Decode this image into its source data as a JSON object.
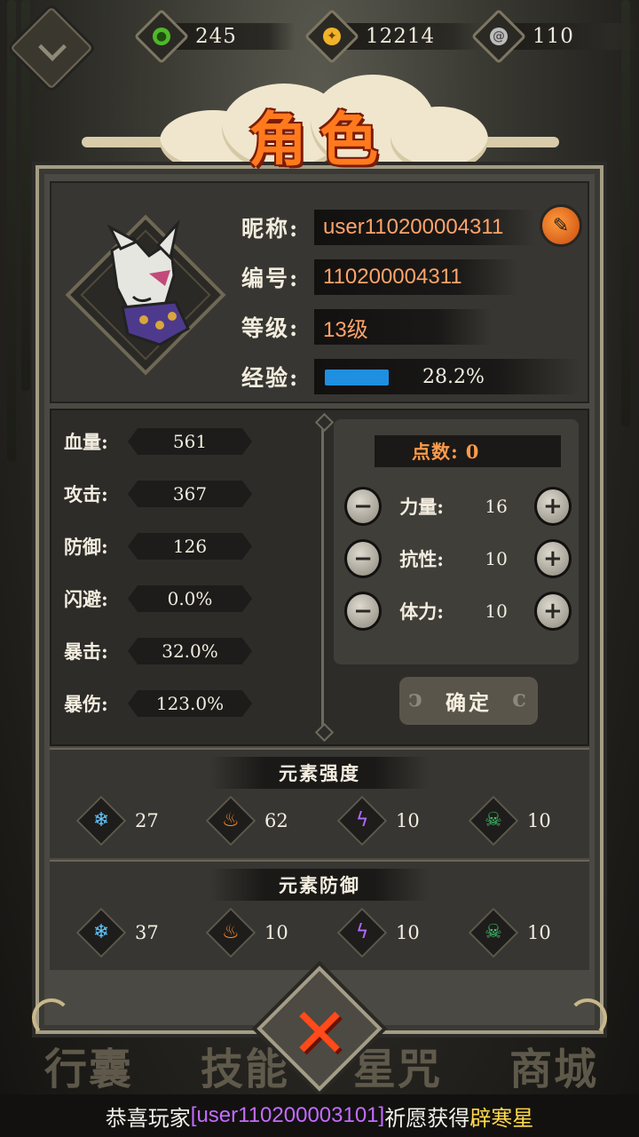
{
  "resources": {
    "jade": {
      "value": "245",
      "icon": "green-jade-icon",
      "color": "#6ad13a"
    },
    "coin": {
      "value": "12214",
      "icon": "gold-coin-icon",
      "color": "#f0b32a"
    },
    "silver": {
      "value": "110",
      "icon": "silver-swirl-icon",
      "color": "#c9c9c9"
    }
  },
  "title": "角色",
  "profile": {
    "nickname_label": "昵称:",
    "nickname": "user110200004311",
    "id_label": "编号:",
    "id": "110200004311",
    "level_label": "等级:",
    "level": "13级",
    "exp_label": "经验:",
    "exp_percent": "28.2%",
    "exp_fraction": 0.282
  },
  "stats": [
    {
      "label": "血量:",
      "value": "561"
    },
    {
      "label": "攻击:",
      "value": "367"
    },
    {
      "label": "防御:",
      "value": "126"
    },
    {
      "label": "闪避:",
      "value": "0.0%"
    },
    {
      "label": "暴击:",
      "value": "32.0%"
    },
    {
      "label": "暴伤:",
      "value": "123.0%"
    }
  ],
  "points": {
    "label": "点数:",
    "value": "0",
    "attributes": [
      {
        "name": "力量:",
        "value": "16"
      },
      {
        "name": "抗性:",
        "value": "10"
      },
      {
        "name": "体力:",
        "value": "10"
      }
    ],
    "confirm_label": "确定"
  },
  "element_strength": {
    "title": "元素强度",
    "items": [
      {
        "icon": "ice-icon",
        "value": "27"
      },
      {
        "icon": "fire-icon",
        "value": "62"
      },
      {
        "icon": "lightning-icon",
        "value": "10"
      },
      {
        "icon": "poison-skull-icon",
        "value": "10"
      }
    ]
  },
  "element_defense": {
    "title": "元素防御",
    "items": [
      {
        "icon": "ice-icon",
        "value": "37"
      },
      {
        "icon": "fire-icon",
        "value": "10"
      },
      {
        "icon": "lightning-icon",
        "value": "10"
      },
      {
        "icon": "poison-skull-icon",
        "value": "10"
      }
    ]
  },
  "bottom_nav": [
    "行囊",
    "技能",
    "星咒",
    "商城"
  ],
  "announcement": {
    "prefix": "恭喜玩家",
    "user": "[user110200003101]",
    "middle": "祈愿获得",
    "item": "辟寒星"
  }
}
